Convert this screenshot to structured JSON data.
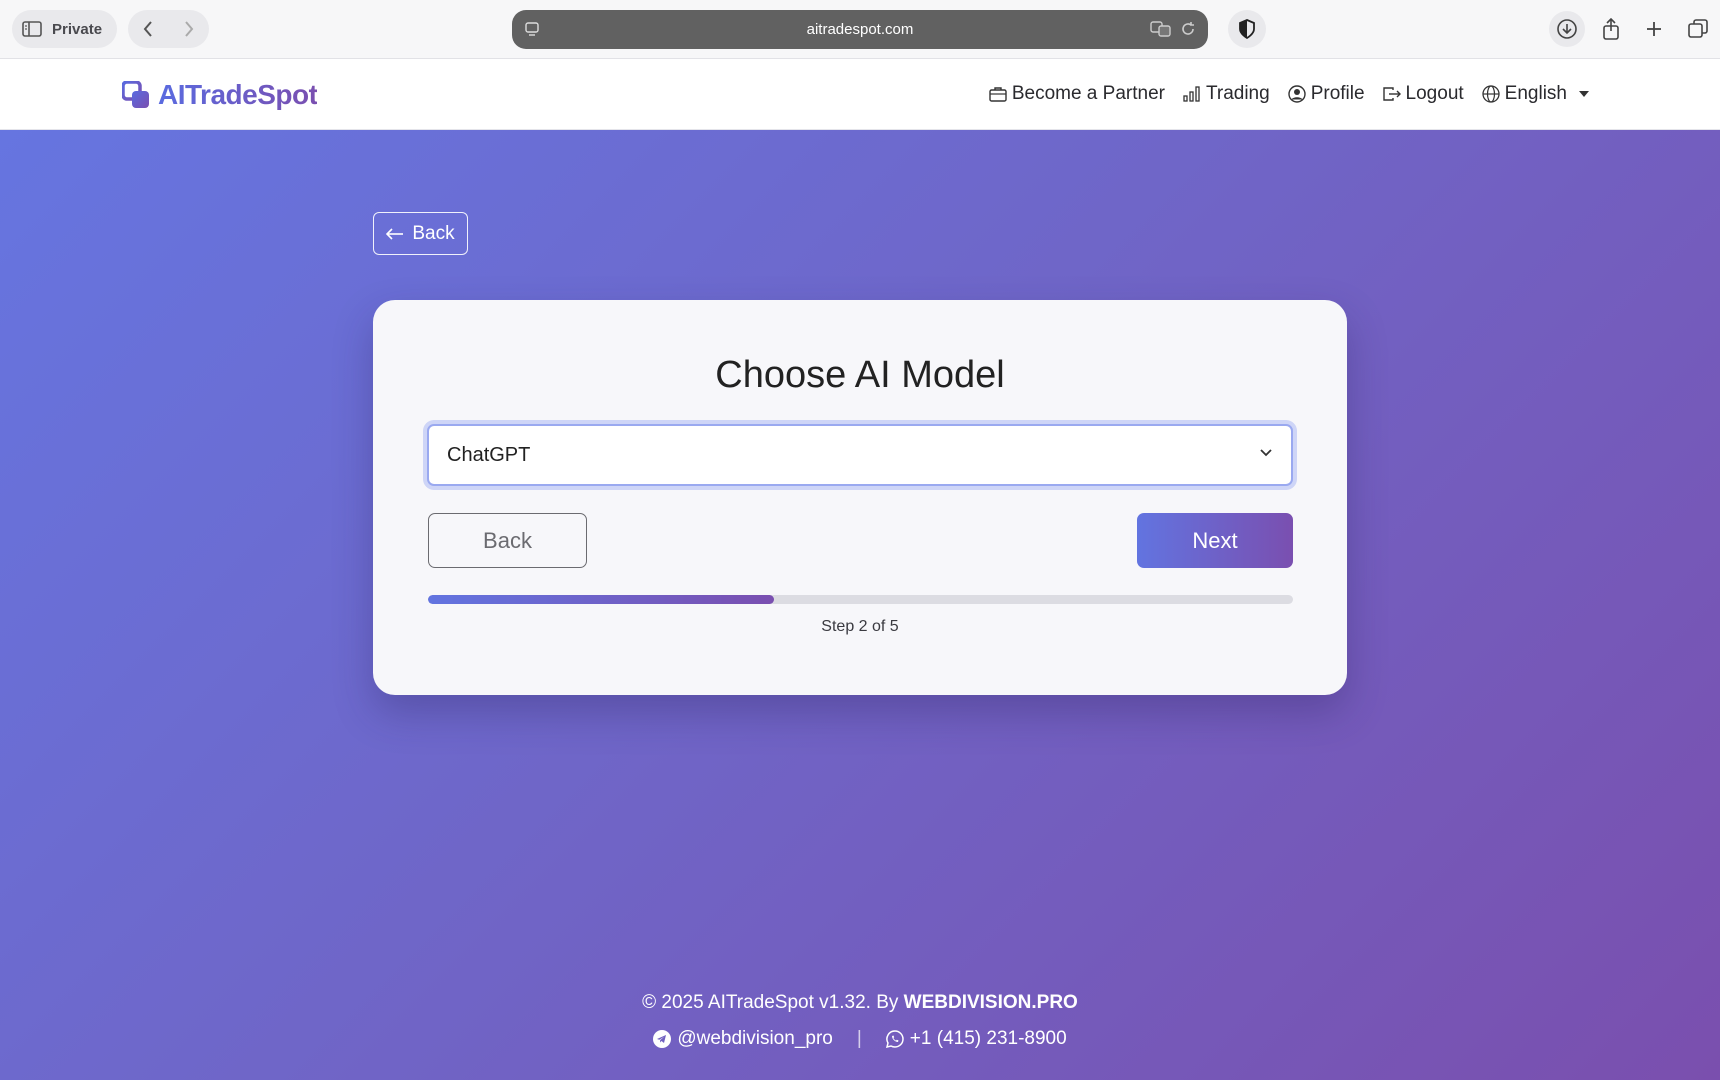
{
  "browser": {
    "private_label": "Private",
    "url": "aitradespot.com"
  },
  "header": {
    "logo_text": "AITradeSpot",
    "nav": [
      {
        "label": "Become a Partner",
        "icon": "briefcase-icon"
      },
      {
        "label": "Trading",
        "icon": "bar-chart-icon"
      },
      {
        "label": "Profile",
        "icon": "user-circle-icon"
      },
      {
        "label": "Logout",
        "icon": "logout-icon"
      },
      {
        "label": "English",
        "icon": "globe-icon"
      }
    ]
  },
  "page": {
    "top_back_label": "Back",
    "card": {
      "title": "Choose AI Model",
      "select_value": "ChatGPT",
      "back_label": "Back",
      "next_label": "Next",
      "progress_fraction": 0.4,
      "step_text": "Step 2 of 5"
    }
  },
  "footer": {
    "copyright": "© 2025 AITradeSpot v1.32. By ",
    "brand": "WEBDIVISION.PRO",
    "telegram": "@webdivision_pro",
    "separator": "|",
    "phone": "+1 (415) 231-8900"
  },
  "colors": {
    "accent_start": "#6274e0",
    "accent_end": "#7a4fb0"
  }
}
